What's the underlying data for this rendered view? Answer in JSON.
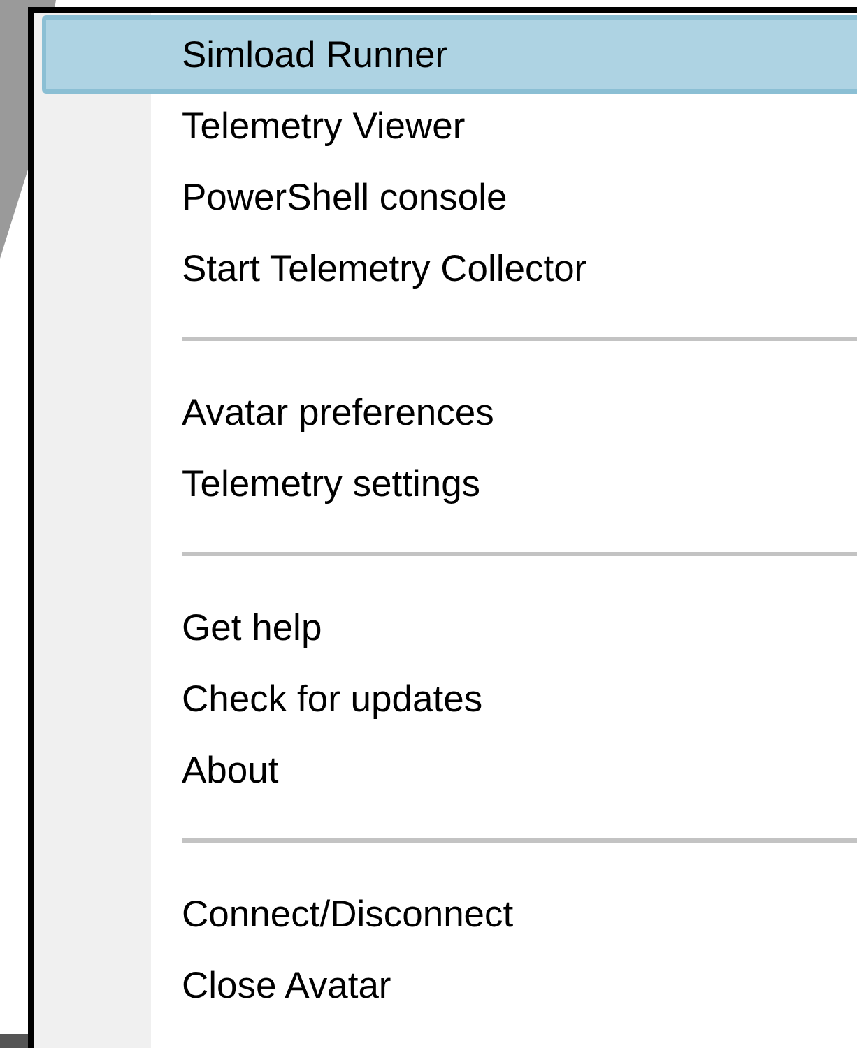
{
  "menu": {
    "sections": [
      {
        "items": [
          {
            "label": "Simload Runner",
            "selected": true
          },
          {
            "label": "Telemetry Viewer",
            "selected": false
          },
          {
            "label": "PowerShell console",
            "selected": false
          },
          {
            "label": "Start Telemetry Collector",
            "selected": false
          }
        ]
      },
      {
        "items": [
          {
            "label": "Avatar preferences",
            "selected": false
          },
          {
            "label": "Telemetry settings",
            "selected": false
          }
        ]
      },
      {
        "items": [
          {
            "label": "Get help",
            "selected": false
          },
          {
            "label": "Check for updates",
            "selected": false
          },
          {
            "label": "About",
            "selected": false
          }
        ]
      },
      {
        "items": [
          {
            "label": "Connect/Disconnect",
            "selected": false
          },
          {
            "label": "Close Avatar",
            "selected": false
          }
        ]
      }
    ]
  }
}
